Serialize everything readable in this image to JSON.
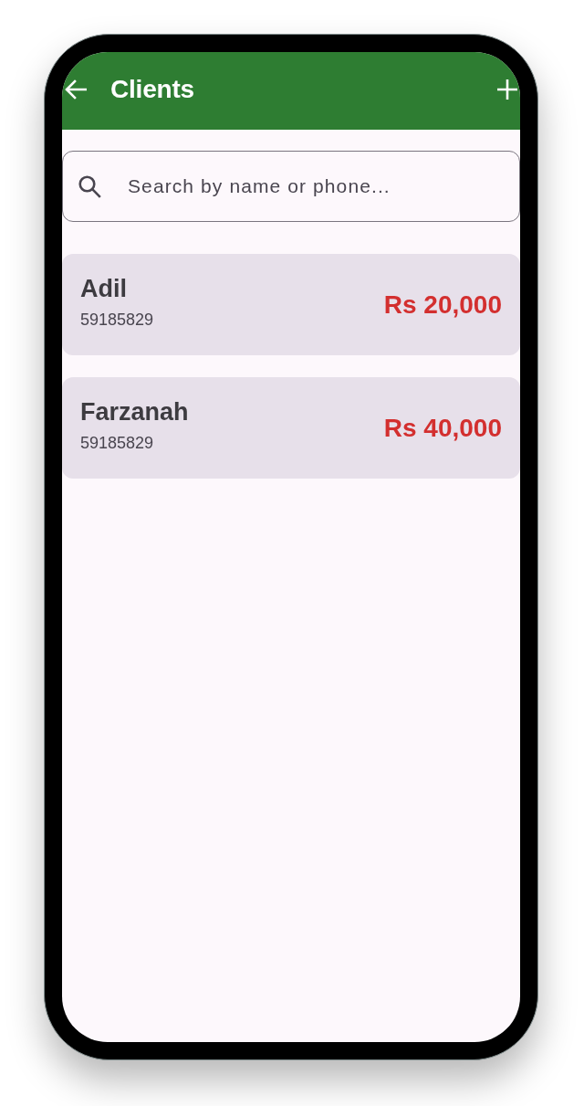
{
  "app_bar": {
    "title": "Clients"
  },
  "search": {
    "placeholder": "Search by name or phone..."
  },
  "clients": [
    {
      "name": "Adil",
      "phone": "59185829",
      "balance": "Rs 20,000"
    },
    {
      "name": "Farzanah",
      "phone": "59185829",
      "balance": "Rs 40,000"
    }
  ]
}
